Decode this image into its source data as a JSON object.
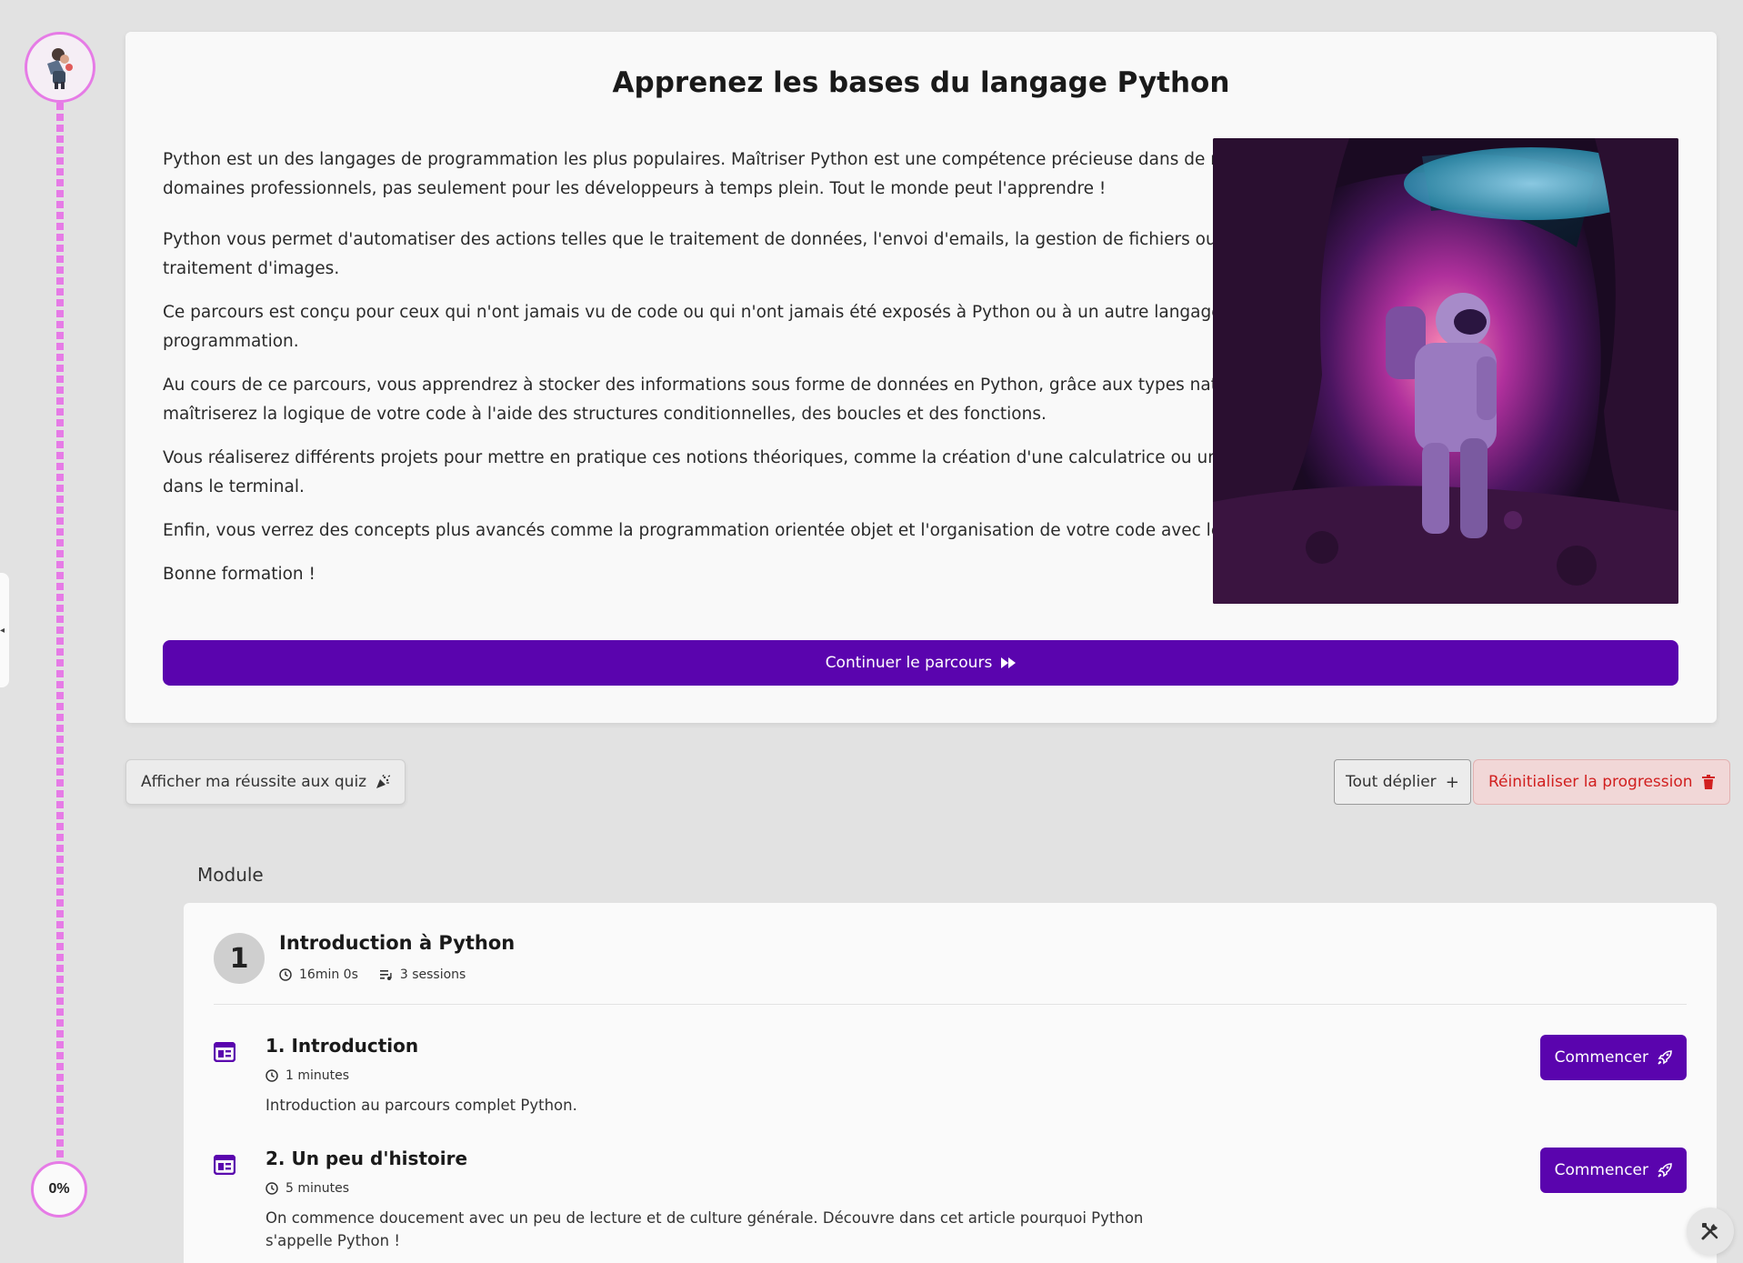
{
  "progress": {
    "percent_label": "0%"
  },
  "intro": {
    "title": "Apprenez les bases du langage Python",
    "paragraphs": [
      "Python est un des langages de programmation les plus populaires. Maîtriser Python est une compétence précieuse dans de nombreux domaines professionnels, pas seulement pour les développeurs à temps plein. Tout le monde peut l'apprendre !",
      "Python vous permet d'automatiser des actions telles que le traitement de données, l'envoi d'emails, la gestion de fichiers ou encore le traitement d'images.",
      "Ce parcours est conçu pour ceux qui n'ont jamais vu de code ou qui n'ont jamais été exposés à Python ou à un autre langage de programmation.",
      "Au cours de ce parcours, vous apprendrez à stocker des informations sous forme de données en Python, grâce aux types natifs. Vous maîtriserez la logique de votre code à l'aide des structures conditionnelles, des boucles et des fonctions.",
      "Vous réaliserez différents projets pour mettre en pratique ces notions théoriques, comme la création d'une calculatrice ou un jeu de rôle dans le terminal.",
      "Enfin, vous verrez des concepts plus avancés comme la programmation orientée objet et l'organisation de votre code avec les modules.",
      "Bonne formation !"
    ],
    "continue_label": "Continuer le parcours"
  },
  "toolbar": {
    "quiz_label": "Afficher ma réussite aux quiz",
    "expand_label": "Tout déplier",
    "reset_label": "Réinitialiser la progression"
  },
  "module": {
    "heading": "Module",
    "number": "1",
    "title": "Introduction à Python",
    "duration": "16min 0s",
    "sessions": "3 sessions",
    "lessons": [
      {
        "title": "1. Introduction",
        "time": "1 minutes",
        "description": "Introduction au parcours complet Python.",
        "button": "Commencer"
      },
      {
        "title": "2. Un peu d'histoire",
        "time": "5 minutes",
        "description": "On commence doucement avec un peu de lecture et de culture générale. Découvre dans cet article pourquoi Python s'appelle Python !",
        "button": "Commencer"
      }
    ]
  },
  "colors": {
    "accent": "#5a04ae",
    "rail": "#e67be6",
    "danger": "#d11f1f",
    "background": "#e2e2e2"
  },
  "icons": {
    "rail_top": "avatar-illustration",
    "continue": "fast-forward-icon",
    "quiz": "party-popper-icon",
    "expand": "plus-icon",
    "reset": "trash-icon",
    "duration": "clock-icon",
    "sessions": "playlist-icon",
    "lesson": "article-icon",
    "start": "rocket-icon",
    "fab": "tools-icon",
    "side_toggle": "chevron-left-icon"
  }
}
